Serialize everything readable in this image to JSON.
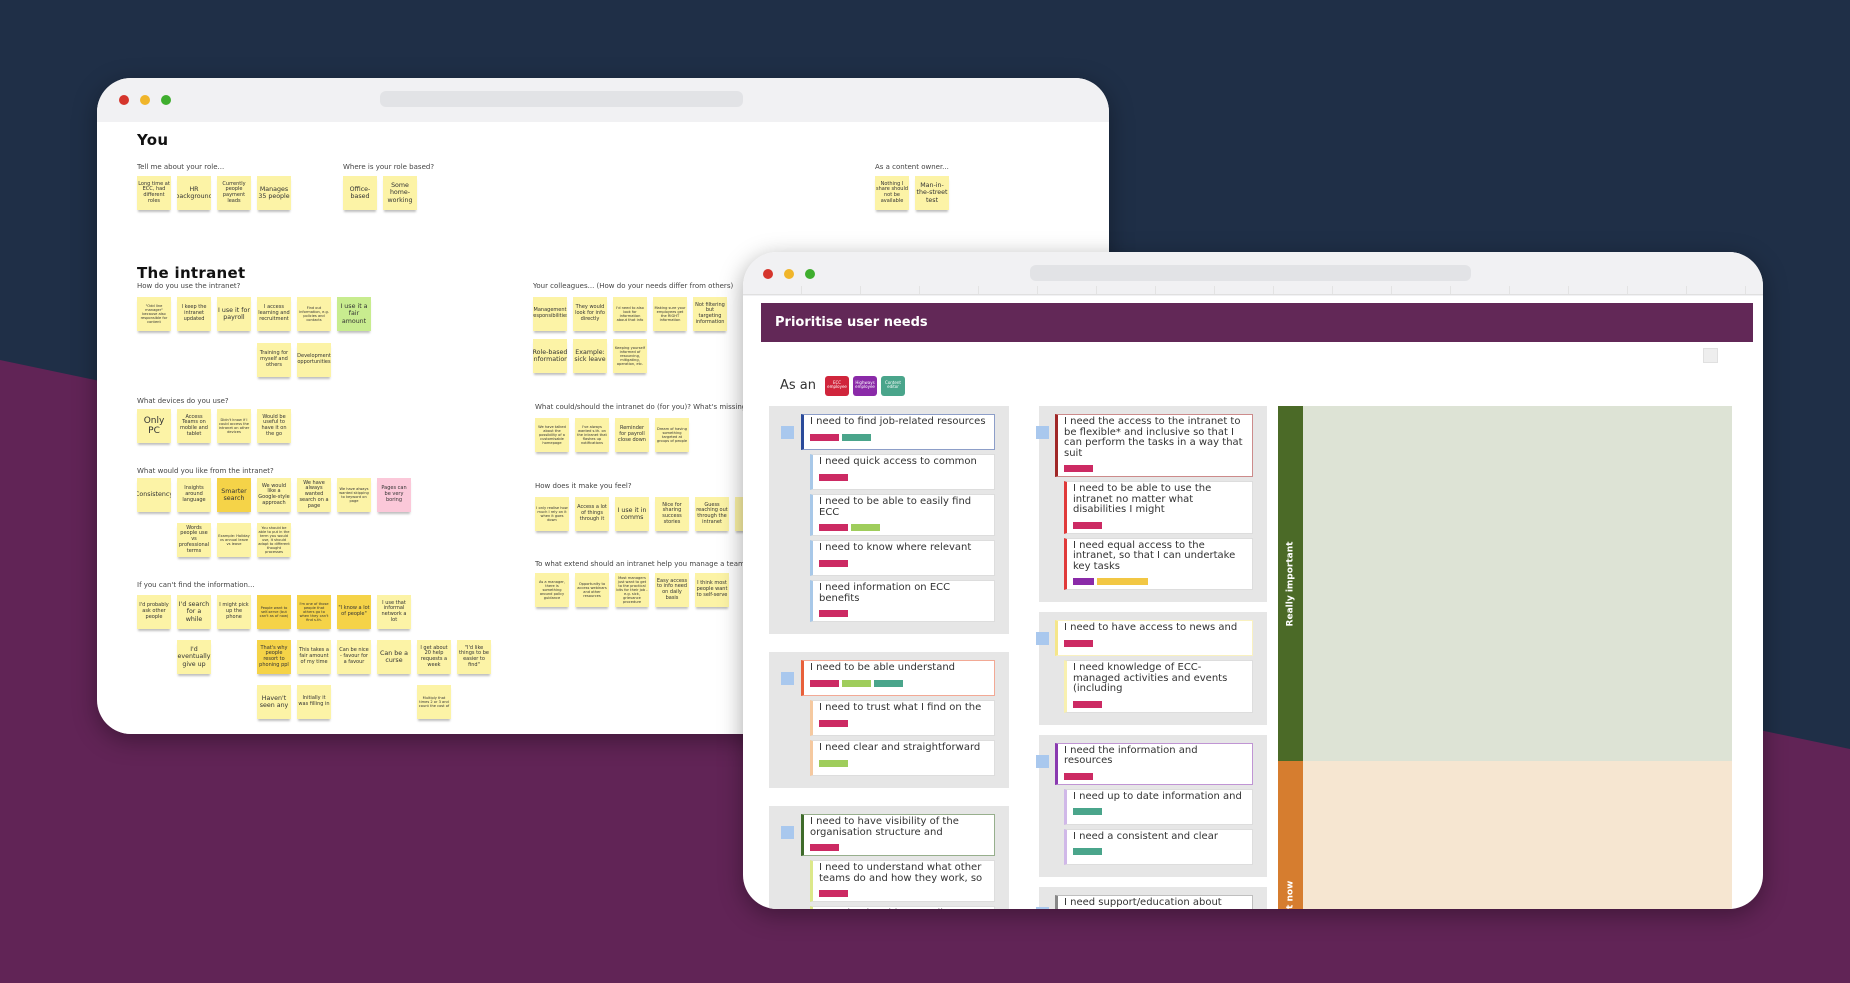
{
  "colors": {
    "navy": "#1f2f47",
    "purple": "#612456",
    "note_yellow": "#fcf3a6",
    "note_gold": "#f5d348",
    "note_green": "#c8ec8f",
    "note_pink": "#fbc8d9"
  },
  "left_window": {
    "heading_you": "You",
    "heading_intranet": "The intranet",
    "sections": [
      {
        "title": "Tell me about your role...",
        "rows": [
          [
            {
              "t": "Long time at ECC, had different roles"
            },
            {
              "t": "HR background"
            },
            {
              "t": "Currently people payment leads"
            },
            {
              "t": "Manages 35 people"
            }
          ]
        ]
      },
      {
        "title": "Where is your role based?",
        "rows": [
          [
            {
              "t": "Office-based"
            },
            {
              "t": "Some home-working"
            }
          ]
        ]
      },
      {
        "title": "As a content owner...",
        "rows": [
          [
            {
              "t": "Nothing I share should not be available"
            },
            {
              "t": "Man-in-the-street test"
            }
          ]
        ]
      },
      {
        "title": "How do you use the intranet?",
        "rows": [
          [
            {
              "t": "\"Odd line manager\" because also responsible for content"
            },
            {
              "t": "I keep the intranet updated"
            },
            {
              "t": "I use it for payroll"
            },
            {
              "t": "I access learning and recruitment"
            },
            {
              "t": "Find out information, e.g. policies and contacts"
            },
            {
              "t": "I use it a fair amount",
              "c": "green"
            }
          ],
          [
            null,
            null,
            null,
            {
              "t": "Training for myself and others"
            },
            {
              "t": "Development opportunities"
            }
          ]
        ]
      },
      {
        "title": "Your colleagues... (How do your needs differ from others)",
        "rows": [
          [
            {
              "t": "Management responsibilities"
            },
            {
              "t": "They would look for info directly"
            },
            {
              "t": "I'd need to also look for information about that info"
            },
            {
              "t": "Making sure your employees get the RIGHT information"
            },
            {
              "t": "Not filtering but targeting information"
            }
          ],
          [
            {
              "t": "Role-based information"
            },
            {
              "t": "Example: sick leave"
            },
            {
              "t": "Keeping yourself informed of resourcing, mitigating, operation, etc."
            }
          ]
        ]
      },
      {
        "title": "What devices do you use?",
        "rows": [
          [
            {
              "t": "Only PC"
            },
            {
              "t": "Access Teams on mobile and tablet"
            },
            {
              "t": "Didn't know if I could access the intranet on other devices"
            },
            {
              "t": "Would be useful to have it on the go"
            }
          ]
        ]
      },
      {
        "title": "What would you like from the intranet?",
        "rows": [
          [
            {
              "t": "Consistency"
            },
            {
              "t": "Insights around language"
            },
            {
              "t": "Smarter search",
              "c": "gold"
            },
            {
              "t": "We would like a Google-style approach"
            },
            {
              "t": "We have always wanted search on a page"
            },
            {
              "t": "We have always wanted skipping to keyword on page"
            },
            {
              "t": "Pages can be very boring",
              "c": "pink"
            }
          ],
          [
            null,
            {
              "t": "Words people use vs professional terms"
            },
            {
              "t": "Example: Holiday vs annual leave vs leave"
            },
            {
              "t": "You should be able to put in the term you would use, it should adapt to different thought processes"
            }
          ]
        ]
      },
      {
        "title": "What could/should the intranet do (for you)? What's missing?",
        "rows": [
          [
            {
              "t": "We have talked about the possibility of a customisable homepage"
            },
            {
              "t": "I've always wanted s.th. on the intranet that flashes up notifications"
            },
            {
              "t": "Reminder for payroll close down"
            },
            {
              "t": "Dream of having something targeted at groups of people"
            }
          ]
        ]
      },
      {
        "title": "How does it make you feel?",
        "rows": [
          [
            {
              "t": "I only realise how much I rely on it when it goes down"
            },
            {
              "t": "Access a lot of things through it"
            },
            {
              "t": "I use it in comms"
            },
            {
              "t": "Nice for sharing success stories"
            },
            {
              "t": "Guess reaching out through the intranet"
            },
            {
              "t": "H..."
            }
          ]
        ]
      },
      {
        "title": "To what extend should an intranet help you manage a team?",
        "rows": [
          [
            {
              "t": "As a manager, there is something around policy guidance"
            },
            {
              "t": "Opportunity to access webinars and other resources"
            },
            {
              "t": "Most managers just want to get to the practical bits for their job - e.g. sick, grievance procedure"
            },
            {
              "t": "Easy access to info need on daily basis"
            },
            {
              "t": "I think most people want to self-serve"
            }
          ]
        ]
      },
      {
        "title": "If you can't find the information...",
        "rows": [
          [
            {
              "t": "I'd probably ask other people"
            },
            {
              "t": "I'd search for a while"
            },
            {
              "t": "I might pick up the phone"
            },
            {
              "t": "People want to self-serve (but can't as of now)",
              "c": "gold"
            },
            {
              "t": "I'm one of those people that others go to when they can't find s.th.",
              "c": "gold"
            },
            {
              "t": "\"I know a lot of people\"",
              "c": "gold"
            },
            {
              "t": "I use that informal network a lot"
            }
          ],
          [
            null,
            {
              "t": "I'd eventually give up"
            },
            null,
            {
              "t": "That's why people resort to phoning ppl",
              "c": "gold"
            },
            {
              "t": "This takes a fair amount of my time"
            },
            {
              "t": "Can be nice - favour for a favour"
            },
            {
              "t": "Can be a curse"
            },
            {
              "t": "I get about 20 help requests a week"
            },
            {
              "t": "\"I'd like things to be easier to find\""
            }
          ],
          [
            null,
            null,
            null,
            {
              "t": "Haven't seen any"
            },
            {
              "t": "Initially it was filling in"
            },
            null,
            null,
            {
              "t": "Multiply that times 2 or 3 and count the cost of"
            }
          ]
        ]
      }
    ]
  },
  "right_window": {
    "title": "Prioritise user needs",
    "as_an": "As an",
    "badges": [
      {
        "label": "ECC employee",
        "color": "#d0253c"
      },
      {
        "label": "Highways employee",
        "color": "#8a2aa8"
      },
      {
        "label": "Content editor",
        "color": "#4aa58b"
      }
    ],
    "tag_colors": {
      "pink": "#cc2a63",
      "teal": "#4aa58b",
      "green": "#9fcd5c",
      "purple": "#8a2aa8",
      "yellow": "#f2c744",
      "blue": "#3e4fa8"
    },
    "left_column": [
      {
        "accent": "#2a4a9a",
        "child_accent": "#a8c8e8",
        "parent": {
          "text": "I need to find job-related resources",
          "tags": [
            "pink",
            "teal"
          ]
        },
        "children": [
          {
            "text": "I need quick access to common",
            "tags": [
              "pink"
            ]
          },
          {
            "text": "I need to be able to easily find ECC",
            "tags": [
              "pink",
              "green"
            ]
          },
          {
            "text": "I need to know where relevant",
            "tags": [
              "pink"
            ]
          },
          {
            "text": "I need  information on ECC benefits",
            "tags": [
              "pink"
            ]
          }
        ]
      },
      {
        "accent": "#e8603a",
        "child_accent": "#f5c9a0",
        "parent": {
          "text": "I need to be able understand",
          "tags": [
            "pink",
            "green",
            "teal"
          ]
        },
        "children": [
          {
            "text": "I need to trust what I find on the",
            "tags": [
              "pink"
            ]
          },
          {
            "text": "I need clear and straightforward",
            "tags": [
              "green"
            ]
          }
        ]
      },
      {
        "accent": "#3e6b2a",
        "child_accent": "#dce88a",
        "parent": {
          "text": "I need to have visibility of the organisation structure and",
          "tags": [
            "pink"
          ]
        },
        "children": [
          {
            "text": "I need to understand what other teams do and how they work, so",
            "tags": [
              "pink"
            ]
          },
          {
            "text": "I need to be able to easily contact",
            "tags": []
          }
        ]
      }
    ],
    "right_column": [
      {
        "accent": "#a02828",
        "child_accent": "#e03a3a",
        "parent": {
          "text": "I need the access to the intranet to be flexible* and inclusive so that I can perform the tasks in a way that suit",
          "tags": [
            "pink"
          ]
        },
        "children": [
          {
            "text": "I need to be able to use the intranet no matter what disabilities I might",
            "tags": [
              "pink"
            ]
          },
          {
            "text": "I need equal access to the intranet, so that I can undertake key tasks",
            "tags": [
              "purple",
              "yellow"
            ]
          }
        ]
      },
      {
        "accent": "#f5e68a",
        "child_accent": "#f8f0b0",
        "parent": {
          "text": "I need to have access to news and",
          "tags": [
            "pink"
          ]
        },
        "children": [
          {
            "text": "I need knowledge of ECC-managed activities and events (including",
            "tags": [
              "pink"
            ]
          }
        ]
      },
      {
        "accent": "#8a3ab0",
        "child_accent": "#d0b8e8",
        "parent": {
          "text": "I need the information and resources",
          "tags": [
            "pink"
          ]
        },
        "children": [
          {
            "text": "I need up to date information and",
            "tags": [
              "teal"
            ]
          },
          {
            "text": "I need a consistent and clear",
            "tags": [
              "teal"
            ]
          }
        ]
      },
      {
        "accent": "#888888",
        "child_accent": "#cccccc",
        "parent": {
          "text": "I need support/education about",
          "tags": [
            "teal",
            "blue"
          ]
        },
        "children": []
      },
      {
        "accent": "#888888",
        "child_accent": "#cccccc",
        "parent": {
          "text": "",
          "tags": []
        },
        "children": []
      }
    ],
    "priority": [
      {
        "label": "Really important",
        "bar": "#4b6a27",
        "area": "#dde3d5"
      },
      {
        "label": "nt now",
        "bar": "#d67d2f",
        "area": "#f6e6d1"
      }
    ]
  }
}
